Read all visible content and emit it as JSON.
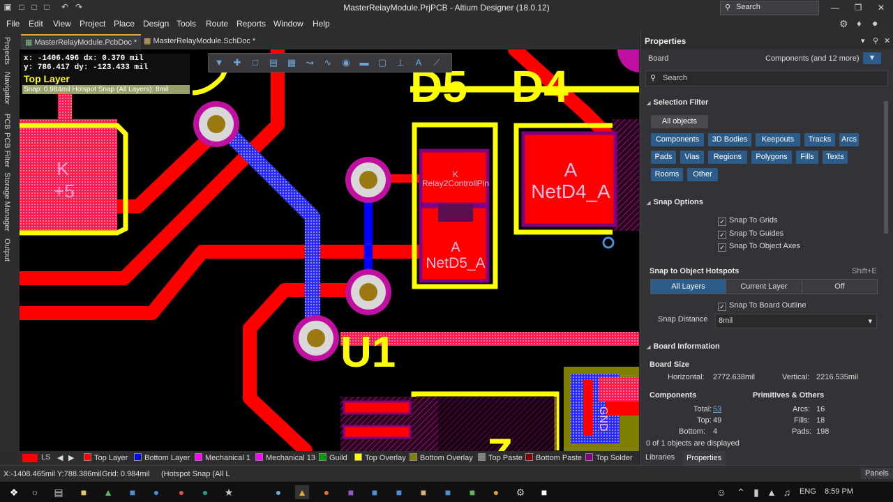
{
  "titlebar": {
    "title": "MasterRelayModule.PrjPCB - Altium Designer (18.0.12)",
    "search_label": "Search"
  },
  "menu": [
    "File",
    "Edit",
    "View",
    "Project",
    "Place",
    "Design",
    "Tools",
    "Route",
    "Reports",
    "Window",
    "Help"
  ],
  "left_rail": [
    "Projects",
    "Navigator",
    "PCB",
    "PCB Filter",
    "Storage Manager",
    "Output"
  ],
  "doc_tabs": [
    {
      "label": "MasterRelayModule.PcbDoc *"
    },
    {
      "label": "MasterRelayModule.SchDoc *"
    }
  ],
  "hud": {
    "line1": "x: -1406.496  dx:   0.370  mil",
    "line2": "y:  786.417   dy: -123.433 mil",
    "layer": "Top Layer",
    "snap": "Snap: 0.984mil Hotspot Snap (All Layers): 8mil"
  },
  "pcb_labels": {
    "d5": "D5",
    "d4": "D4",
    "k_pad": "K",
    "plus5": "+5",
    "k_small": "K",
    "relay": "Relay2ControllPin",
    "a1": "A",
    "netd5": "NetD5_A",
    "a2": "A",
    "netd4": "NetD4_A",
    "u1": "U1",
    "z": "Z",
    "gnd": "GND"
  },
  "layers": [
    {
      "label": "Top Layer",
      "color": "#ff0000"
    },
    {
      "label": "Bottom Layer",
      "color": "#0000ff"
    },
    {
      "label": "Mechanical 1",
      "color": "#ff00ff"
    },
    {
      "label": "Mechanical 13",
      "color": "#ff00ff"
    },
    {
      "label": "Guild",
      "color": "#00a000"
    },
    {
      "label": "Top Overlay",
      "color": "#ffff00"
    },
    {
      "label": "Bottom Overlay",
      "color": "#808000"
    },
    {
      "label": "Top Paste",
      "color": "#808080"
    },
    {
      "label": "Bottom Paste",
      "color": "#800000"
    },
    {
      "label": "Top Solder",
      "color": "#800080"
    }
  ],
  "layer_ls": "LS",
  "bottom_tabs": {
    "libraries": "Libraries",
    "properties": "Properties"
  },
  "status": {
    "coords": "X:-1408.465mil Y:788.386mil",
    "grid": "Grid: 0.984mil",
    "snap": "(Hotspot Snap (All L",
    "panels": "Panels"
  },
  "panel": {
    "title": "Properties",
    "board": "Board",
    "components_filter": "Components (and 12 more)",
    "search_placeholder": "Search",
    "selection_filter": "Selection Filter",
    "all_objects": "All objects",
    "filters": [
      "Components",
      "3D Bodies",
      "Keepouts",
      "Tracks",
      "Arcs",
      "Pads",
      "Vias",
      "Regions",
      "Polygons",
      "Fills",
      "Texts",
      "Rooms",
      "Other"
    ],
    "snap_options": "Snap Options",
    "snap_grids": "Snap To Grids",
    "snap_guides": "Snap To Guides",
    "snap_axes": "Snap To Object Axes",
    "hotspots": "Snap to Object Hotspots",
    "shortcut": "Shift+E",
    "seg_all": "All Layers",
    "seg_current": "Current Layer",
    "seg_off": "Off",
    "snap_outline": "Snap To Board Outline",
    "snap_distance_label": "Snap Distance",
    "snap_distance_value": "8mil",
    "board_info": "Board Information",
    "board_size": "Board Size",
    "horizontal_label": "Horizontal:",
    "horizontal_value": "2772.638mil",
    "vertical_label": "Vertical:",
    "vertical_value": "2216.535mil",
    "components": "Components",
    "primitives": "Primitives & Others",
    "total_label": "Total:",
    "total_value": "53",
    "top_label": "Top:",
    "top_value": "49",
    "bottom_label": "Bottom:",
    "bottom_value": "4",
    "arcs_label": "Arcs:",
    "arcs_value": "16",
    "fills_label": "Fills:",
    "fills_value": "18",
    "pads_label": "Pads:",
    "pads_value": "198",
    "objects_count": "0 of 1 objects are displayed"
  },
  "taskbar": {
    "lang": "ENG",
    "time": "8:59 PM"
  }
}
